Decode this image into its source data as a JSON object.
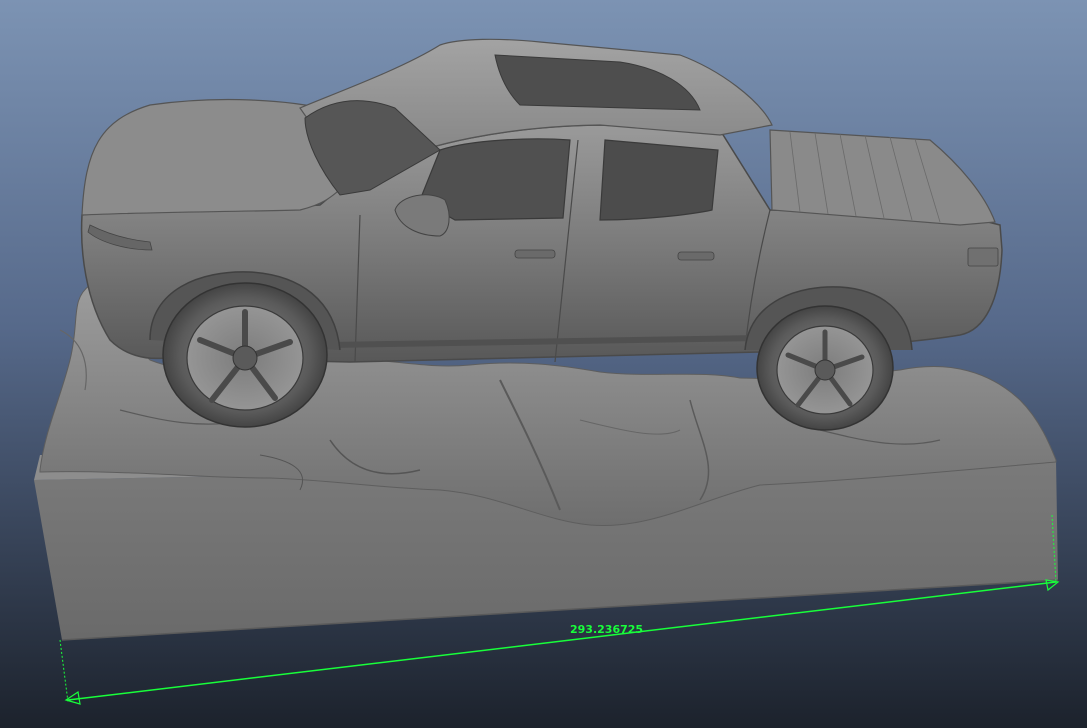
{
  "viewport": {
    "background_top": "#7c93b3",
    "background_bottom": "#1c222c"
  },
  "measurement": {
    "value": "293.236725",
    "color": "#18ff3a"
  },
  "model": {
    "shade_light": "#8e8e8e",
    "shade_mid": "#6f6f6f",
    "shade_dark": "#3e3e3e"
  }
}
